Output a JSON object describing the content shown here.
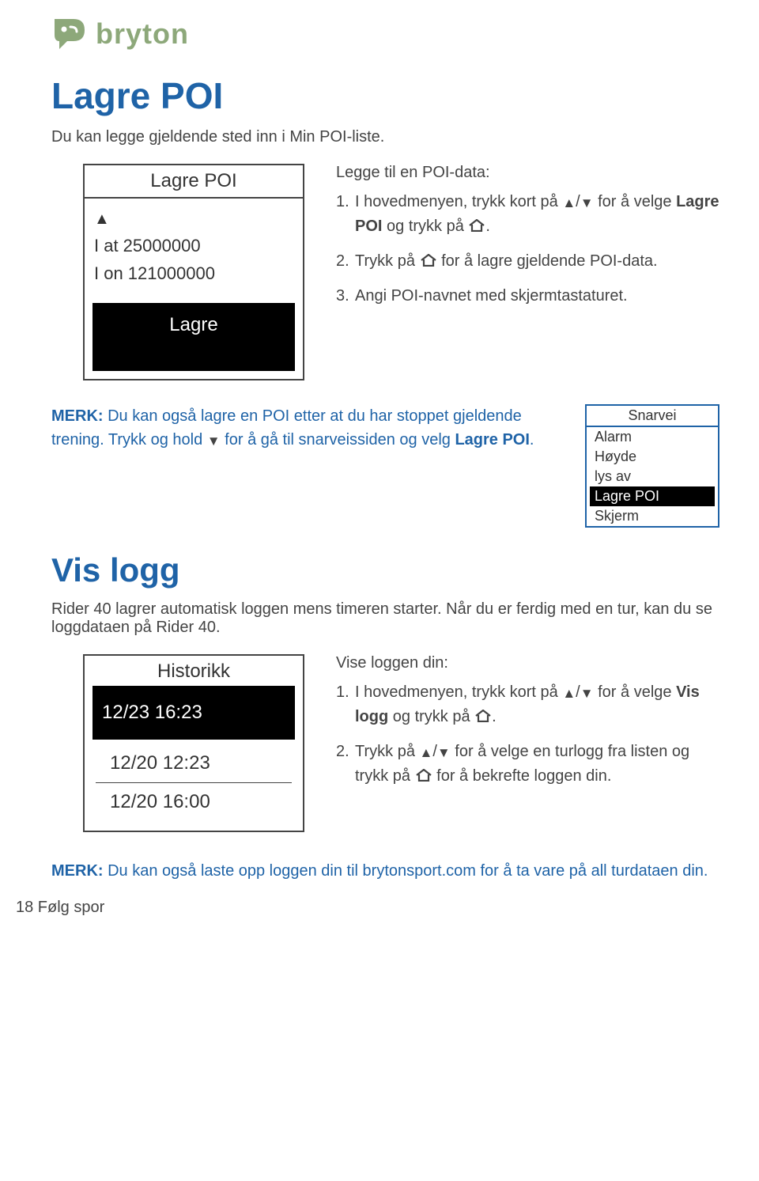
{
  "brand": "bryton",
  "section_title_1": "Lagre POI",
  "intro_1": "Du kan legge gjeldende sted inn i Min POI-liste.",
  "device1": {
    "title": "Lagre POI",
    "line1": "I at  25000000",
    "line2": "I on 121000000",
    "button": "Lagre"
  },
  "steps1": {
    "lead": "Legge til en POI-data:",
    "items": [
      {
        "num": "1.",
        "pre": "I hovedmenyen, trykk kort på ",
        "mid": " for å velge ",
        "bold": "Lagre POI",
        "post": " og trykk på ",
        "end": "."
      },
      {
        "num": "2.",
        "pre": "Trykk på ",
        "post": " for å lagre gjeldende POI-data."
      },
      {
        "num": "3.",
        "text": "Angi POI-navnet med skjermtastaturet."
      }
    ]
  },
  "note1": {
    "merk": "MERK:",
    "text1": " Du kan også lagre en POI etter at du har stoppet gjeldende trening. Trykk og hold ",
    "text2": " for å gå til snarveissiden og velg ",
    "bold": "Lagre POI",
    "end": "."
  },
  "mini": {
    "title": "Snarvei",
    "items": [
      "Alarm",
      "Høyde",
      "lys av",
      "Lagre POI",
      "Skjerm"
    ],
    "selected_index": 3
  },
  "section_title_2": "Vis logg",
  "intro_2": "Rider 40 lagrer automatisk loggen mens timeren starter. Når du er ferdig med en tur, kan du se loggdataen på Rider 40.",
  "device2": {
    "title": "Historikk",
    "rows": [
      "12/23  16:23",
      "12/20  12:23",
      "12/20  16:00"
    ]
  },
  "steps2": {
    "lead": "Vise loggen din:",
    "items": [
      {
        "num": "1.",
        "pre": "I hovedmenyen, trykk kort på ",
        "mid": " for å velge ",
        "bold": "Vis logg",
        "post": " og trykk på ",
        "end": "."
      },
      {
        "num": "2.",
        "pre": "Trykk på ",
        "mid": " for å velge en turlogg fra listen og trykk på ",
        "post": " for å bekrefte loggen din."
      }
    ]
  },
  "note2": {
    "merk": "MERK:",
    "text": " Du kan også laste opp loggen din til brytonsport.com for å ta vare på all turdataen din."
  },
  "footer": "18    Følg spor"
}
